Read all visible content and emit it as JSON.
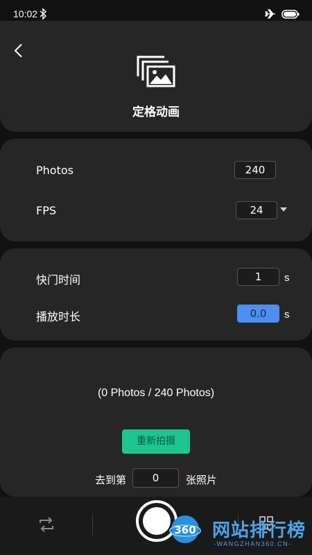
{
  "status_bar": {
    "time": "10:02"
  },
  "header": {
    "title": "定格动画"
  },
  "video_settings": {
    "photos_label": "Photos",
    "photos_value": "240",
    "fps_label": "FPS",
    "fps_value": "24"
  },
  "time_settings": {
    "shutter_label": "快门时间",
    "shutter_value": "1",
    "shutter_unit": "s",
    "duration_label": "播放时长",
    "duration_value": "0.0",
    "duration_unit": "s"
  },
  "progress": {
    "text": "(0 Photos / 240 Photos)",
    "reshoot_label": "重新拍摄",
    "goto_prefix": "去到第",
    "goto_value": "0",
    "goto_suffix": "张照片"
  },
  "watermark": {
    "text": "网站排行榜",
    "sub": "-WANGZHAN360.CN-",
    "logo_text": "360"
  },
  "colors": {
    "accent_green": "#1fc490",
    "accent_blue": "#4d8ff1",
    "card": "#262626",
    "background": "#111111"
  }
}
